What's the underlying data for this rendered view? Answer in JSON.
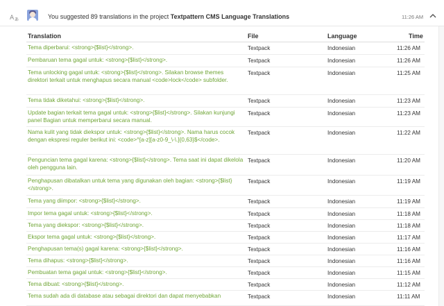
{
  "header": {
    "summary_prefix": "You suggested 89 translations in the project ",
    "project_name": "Textpattern CMS Language Translations",
    "time": "11:26 AM"
  },
  "table": {
    "columns": {
      "translation": "Translation",
      "file": "File",
      "language": "Language",
      "time": "Time"
    },
    "rows": [
      {
        "translation": "Tema diperbarui: <strong>{$list}</strong>.",
        "file": "Textpack",
        "language": "Indonesian",
        "time": "11:26 AM"
      },
      {
        "translation": "Pembaruan tema gagal untuk: <strong>{$list}</strong>.",
        "file": "Textpack",
        "language": "Indonesian",
        "time": "11:26 AM"
      },
      {
        "translation": "Tema unlocking gagal untuk: <strong>{$list}</strong>. Silakan browse themes direktori terkait untuk menghapus secara manual <code>lock</code> subfolder.",
        "file": "Textpack",
        "language": "Indonesian",
        "time": "11:25 AM"
      },
      {
        "translation": "Tema tidak diketahui: <strong>{$list}</strong>.",
        "file": "Textpack",
        "language": "Indonesian",
        "time": "11:23 AM"
      },
      {
        "translation": "Update bagian terkait tema gagal untuk: <strong>{$list}</strong>. Silakan kunjungi panel Bagian untuk memperbarui secara manual.",
        "file": "Textpack",
        "language": "Indonesian",
        "time": "11:23 AM"
      },
      {
        "translation": "Nama kulit yang tidak diekspor untuk: <strong>{$list}</strong>. Nama harus cocok dengan ekspresi reguler berikut ini: <code>^[a-z][a-z0-9_\\-\\.]{0,63}$</code>.",
        "file": "Textpack",
        "language": "Indonesian",
        "time": "11:22 AM"
      },
      {
        "translation": "Penguncian tema gagal karena: <strong>{$list}</strong>. Tema saat ini dapat dikelola oleh pengguna lain.",
        "file": "Textpack",
        "language": "Indonesian",
        "time": "11:20 AM"
      },
      {
        "translation": "Penghapusan dibatalkan untuk tema yang digunakan oleh bagian: <strong>{$list}</strong>.",
        "file": "Textpack",
        "language": "Indonesian",
        "time": "11:19 AM"
      },
      {
        "translation": "Tema yang diimpor: <strong>{$list}</strong>.",
        "file": "Textpack",
        "language": "Indonesian",
        "time": "11:19 AM"
      },
      {
        "translation": "Impor tema gagal untuk: <strong>{$list}</strong>.",
        "file": "Textpack",
        "language": "Indonesian",
        "time": "11:18 AM"
      },
      {
        "translation": "Tema yang diekspor: <strong>{$list}</strong>.",
        "file": "Textpack",
        "language": "Indonesian",
        "time": "11:18 AM"
      },
      {
        "translation": "Ekspor tema gagal untuk: <strong>{$list}</strong>.",
        "file": "Textpack",
        "language": "Indonesian",
        "time": "11:17 AM"
      },
      {
        "translation": "Penghapusan tema(s) gagal karena: <strong>{$list}</strong>.",
        "file": "Textpack",
        "language": "Indonesian",
        "time": "11:16 AM"
      },
      {
        "translation": "Tema dihapus: <strong>{$list}</strong>.",
        "file": "Textpack",
        "language": "Indonesian",
        "time": "11:16 AM"
      },
      {
        "translation": "Pembuatan tema gagal untuk: <strong>{$list}</strong>.",
        "file": "Textpack",
        "language": "Indonesian",
        "time": "11:15 AM"
      },
      {
        "translation": "Tema dibuat: <strong>{$list}</strong>.",
        "file": "Textpack",
        "language": "Indonesian",
        "time": "11:12 AM"
      },
      {
        "translation": "Tema sudah ada di database atau sebagai direktori dan dapat menyebabkan",
        "file": "Textpack",
        "language": "Indonesian",
        "time": "11:11 AM"
      }
    ]
  },
  "icons": {
    "translate": "translate-icon",
    "collapse": "chevron-up-icon"
  },
  "colors": {
    "translation_text": "#6fa535",
    "avatar": "#8aa3dd"
  }
}
